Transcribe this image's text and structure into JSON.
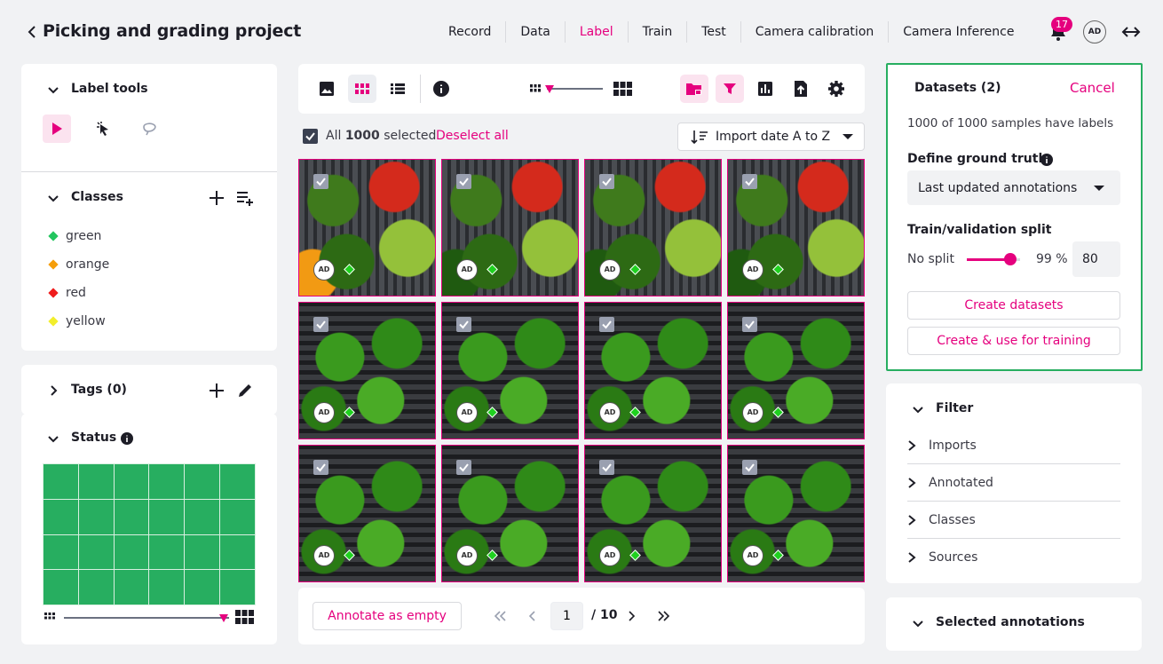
{
  "header": {
    "title": "Picking and grading project",
    "nav": [
      "Record",
      "Data",
      "Label",
      "Train",
      "Test",
      "Camera calibration",
      "Camera Inference"
    ],
    "active_nav": "Label",
    "notification_count": "17",
    "avatar": "AD"
  },
  "left": {
    "label_tools_title": "Label tools",
    "classes_title": "Classes",
    "classes": [
      {
        "name": "green",
        "color": "#22c55e"
      },
      {
        "name": "orange",
        "color": "#f59e0b"
      },
      {
        "name": "red",
        "color": "#ef1c1c"
      },
      {
        "name": "yellow",
        "color": "#f2ee2c"
      }
    ],
    "tags_title": "Tags (0)",
    "status_title": "Status",
    "status_color": "#27ae60"
  },
  "middle": {
    "select_all_prefix": "All",
    "select_count": "1000",
    "select_suffix": "selected",
    "deselect_label": "Deselect all",
    "sort_label": "Import date A to Z",
    "thumbnail_avatar": "AD",
    "annotate_empty_label": "Annotate as empty",
    "page_current": "1",
    "page_total": "/ 10"
  },
  "right": {
    "datasets_title": "Datasets (2)",
    "cancel_label": "Cancel",
    "samples_text": "1000 of 1000 samples have labels",
    "ground_truth_label": "Define ground truth",
    "ground_truth_value": "Last updated annotations",
    "split_label": "Train/validation split",
    "no_split_label": "No split",
    "split_percent": "99 %",
    "split_value": "80",
    "split_level": 0.82,
    "create_datasets_label": "Create datasets",
    "create_use_label": "Create & use for training",
    "filter_title": "Filter",
    "filters": [
      "Imports",
      "Annotated",
      "Classes",
      "Sources"
    ],
    "selected_annotations_title": "Selected annotations"
  },
  "colors": {
    "accent": "#e5007e",
    "success": "#27ae60"
  }
}
